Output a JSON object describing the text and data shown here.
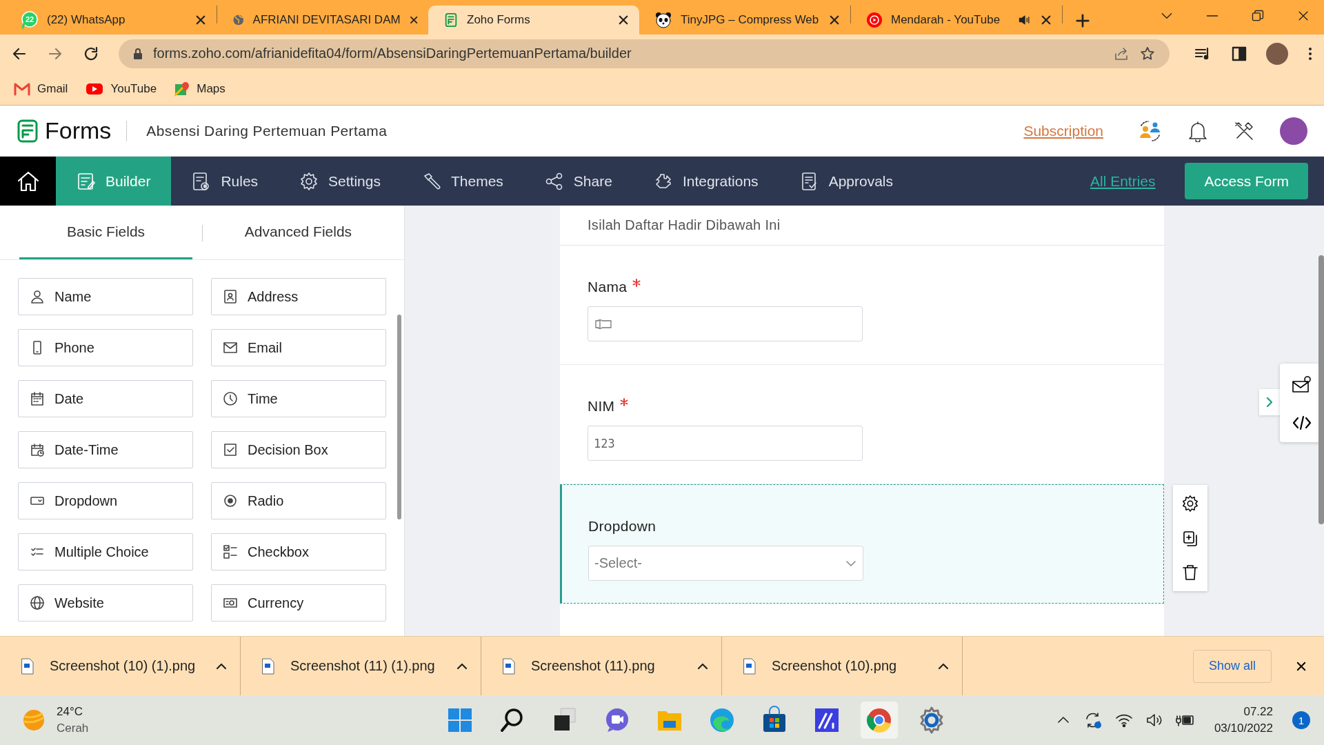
{
  "browser": {
    "tabs": [
      {
        "title": "(22) WhatsApp",
        "badge": "22",
        "selected": false,
        "audible": false
      },
      {
        "title": "AFRIANI DEVITASARI DAM",
        "selected": false,
        "audible": false
      },
      {
        "title": "Zoho Forms",
        "selected": true,
        "audible": false
      },
      {
        "title": "TinyJPG – Compress Web",
        "selected": false,
        "audible": false
      },
      {
        "title": "Mendarah - YouTube",
        "selected": false,
        "audible": true
      }
    ],
    "url": "forms.zoho.com/afrianidefita04/form/AbsensiDaringPertemuanPertama/builder",
    "bookmarks": [
      "Gmail",
      "YouTube",
      "Maps"
    ]
  },
  "header": {
    "app_name": "Forms",
    "form_title": "Absensi Daring Pertemuan Pertama",
    "subscription_link": "Subscription"
  },
  "nav": {
    "items": [
      {
        "label": "Builder",
        "selected": true
      },
      {
        "label": "Rules",
        "selected": false
      },
      {
        "label": "Settings",
        "selected": false
      },
      {
        "label": "Themes",
        "selected": false
      },
      {
        "label": "Share",
        "selected": false
      },
      {
        "label": "Integrations",
        "selected": false
      },
      {
        "label": "Approvals",
        "selected": false
      }
    ],
    "all_entries_link": "All Entries",
    "access_button": "Access Form"
  },
  "palette": {
    "tabs": [
      {
        "label": "Basic Fields",
        "selected": true
      },
      {
        "label": "Advanced Fields",
        "selected": false
      }
    ],
    "fields": [
      "Name",
      "Address",
      "Phone",
      "Email",
      "Date",
      "Time",
      "Date-Time",
      "Decision Box",
      "Dropdown",
      "Radio",
      "Multiple Choice",
      "Checkbox",
      "Website",
      "Currency"
    ]
  },
  "form": {
    "description": "Isilah Daftar Hadir Dibawah Ini",
    "fields": [
      {
        "kind": "text",
        "label": "Nama",
        "required": true,
        "selected": false
      },
      {
        "kind": "number",
        "label": "NIM",
        "required": true,
        "placeholder": "123",
        "selected": false
      },
      {
        "kind": "dropdown",
        "label": "Dropdown",
        "required": false,
        "placeholder": "-Select-",
        "selected": true
      }
    ]
  },
  "downloads": {
    "files": [
      "Screenshot (10) (1).png",
      "Screenshot (11) (1).png",
      "Screenshot (11).png",
      "Screenshot (10).png"
    ],
    "show_all": "Show all"
  },
  "taskbar": {
    "temperature": "24°C",
    "weather": "Cerah",
    "time": "07.22",
    "date": "03/10/2022",
    "notifications": "1"
  }
}
